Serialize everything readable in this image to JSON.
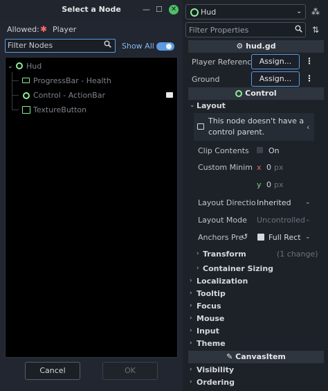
{
  "dialog": {
    "title": "Select a Node",
    "window_buttons": {
      "minimize": "—",
      "maximize": "☐"
    },
    "allowed_label": "Allowed:",
    "allowed_type": "Player",
    "filter_placeholder": "Filter Nodes",
    "show_all_label": "Show All",
    "show_all_on": true,
    "tree": [
      {
        "label": "Hud",
        "icon": "control-circle-icon",
        "depth": 0,
        "expanded": true
      },
      {
        "label": "ProgressBar - Health",
        "icon": "progressbar-icon",
        "depth": 1
      },
      {
        "label": "Control - ActionBar",
        "icon": "control-circle-icon",
        "depth": 1,
        "badge": "film-icon"
      },
      {
        "label": "TextureButton",
        "icon": "texturebutton-icon",
        "depth": 1
      }
    ],
    "cancel_label": "Cancel",
    "ok_label": "OK"
  },
  "inspector": {
    "node_name": "Hud",
    "filter_placeholder": "Filter Properties",
    "script_header": "hud.gd",
    "properties": [
      {
        "label": "Player Referenc",
        "button": "Assign..."
      },
      {
        "label": "Ground",
        "button": "Assign..."
      }
    ],
    "control_header": "Control",
    "layout_label": "Layout",
    "warning_text_line1": "This node doesn't have a",
    "warning_text_line2": "control parent.",
    "clip_contents_label": "Clip Contents",
    "clip_contents_value": "On",
    "custom_min_label": "Custom Minim",
    "custom_min_x_axis": "x",
    "custom_min_x_value": "0",
    "custom_min_y_axis": "y",
    "custom_min_y_value": "0",
    "custom_min_unit": "px",
    "layout_direction_label": "Layout Directio",
    "layout_direction_value": "Inherited",
    "layout_mode_label": "Layout Mode",
    "layout_mode_value": "Uncontrolled",
    "anchors_label": "Anchors Pre",
    "anchors_value": "Full Rect",
    "transform_label": "Transform",
    "transform_changes": "(1 change)",
    "container_sizing_label": "Container Sizing",
    "categories": [
      "Localization",
      "Tooltip",
      "Focus",
      "Mouse",
      "Input",
      "Theme"
    ],
    "canvasitem_header": "CanvasItem",
    "categories2": [
      "Visibility",
      "Ordering"
    ]
  },
  "colors": {
    "accent": "#5d9be0",
    "node_green": "#8eef97",
    "close_green": "#4fbf6a",
    "player_red": "#ff6b6b",
    "x_axis": "#e16a6a",
    "y_axis": "#8ad27a"
  }
}
